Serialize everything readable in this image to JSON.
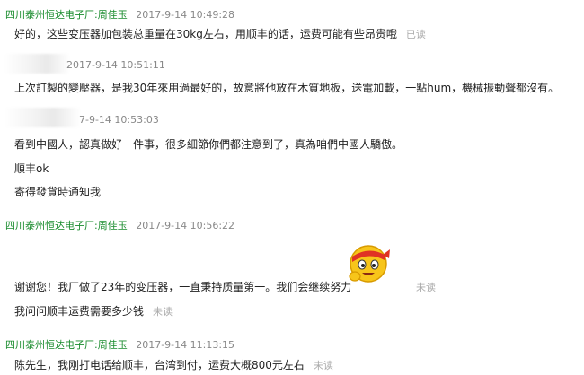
{
  "messages": [
    {
      "sender": "四川泰州恒达电子厂:周佳玉",
      "time": "2017-9-14 10:49:28",
      "lines": [
        "好的，这些变压器加包装总重量在30kg左右，用顺丰的话，运费可能有些昂贵哦"
      ],
      "status": "已读"
    },
    {
      "sender": "",
      "time": "2017-9-14 10:51:11",
      "lines": [
        "上次訂製的變壓器，是我30年來用過最好的，故意將他放在木質地板，送電加載，一點hum，機械振動聲都沒有。"
      ]
    },
    {
      "sender": "",
      "time": "2017-9-14 10:53:03",
      "time_visible": "7-9-14 10:53:03",
      "lines": [
        "看到中國人，認真做好一件事，很多細節你們都注意到了，真為咱們中國人驕傲。",
        "順丰ok",
        "寄得發貨時通知我"
      ]
    },
    {
      "sender": "四川泰州恒达电子厂:周佳玉",
      "time": "2017-9-14 10:56:22",
      "lines": [
        "谢谢您！我厂做了23年的变压器，一直秉持质量第一。我们会继续努力",
        "我问问顺丰运费需要多少钱"
      ],
      "statuses": [
        "未读",
        "未读"
      ],
      "emoji": "strong-emoji-icon"
    },
    {
      "sender": "四川泰州恒达电子厂:周佳玉",
      "time": "2017-9-14 11:13:15",
      "lines": [
        "陈先生，我刚打电话给顺丰，台湾到付，运费大概800元左右"
      ],
      "status": "未读"
    }
  ],
  "colors": {
    "seller_name": "#1a8c2e",
    "time": "#888888",
    "status": "#aaaaaa"
  }
}
